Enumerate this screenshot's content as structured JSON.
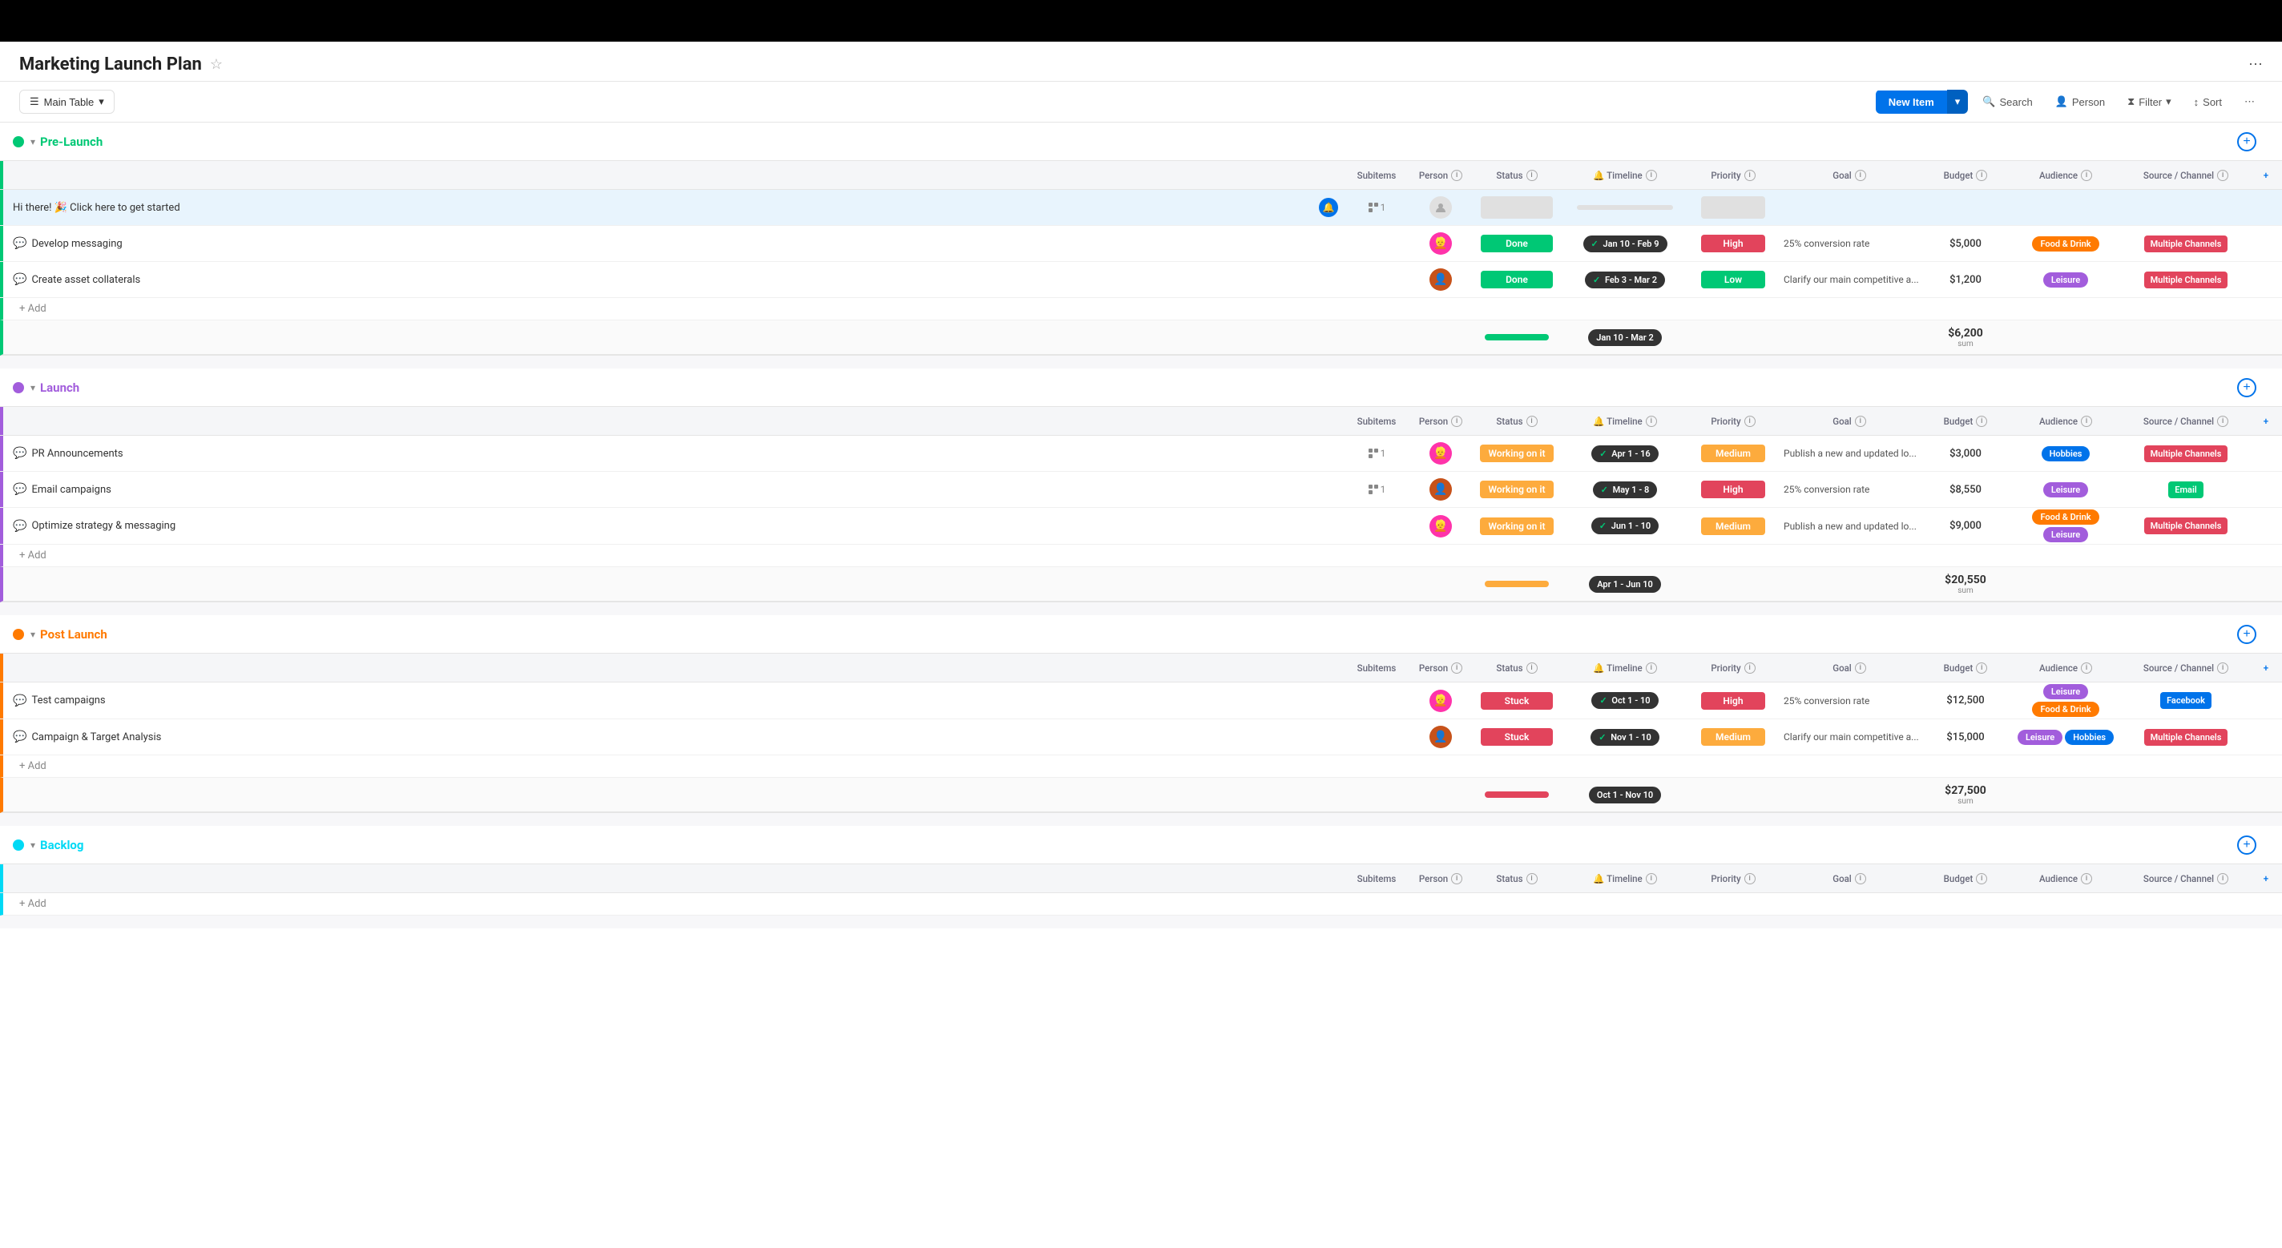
{
  "app": {
    "title": "Marketing Launch Plan",
    "more_icon": "⋯"
  },
  "toolbar": {
    "main_table_label": "Main Table",
    "new_item_label": "New Item",
    "search_label": "Search",
    "person_label": "Person",
    "filter_label": "Filter",
    "sort_label": "Sort",
    "more_label": "⋯"
  },
  "columns": {
    "name_label": "",
    "subitems_label": "Subitems",
    "person_label": "Person",
    "status_label": "Status",
    "timeline_label": "Timeline",
    "priority_label": "Priority",
    "goal_label": "Goal",
    "budget_label": "Budget",
    "audience_label": "Audience",
    "source_label": "Source / Channel"
  },
  "groups": [
    {
      "id": "pre-launch",
      "title": "Pre-Launch",
      "color": "green",
      "items": [
        {
          "name": "Hi there! 🎉 Click here to get started",
          "is_highlight": true,
          "subitems": "1",
          "person": "empty",
          "status": "",
          "status_class": "status-empty",
          "timeline": "",
          "priority": "",
          "priority_class": "priority-empty",
          "goal": "",
          "budget": "",
          "audience": [],
          "source": ""
        },
        {
          "name": "Develop messaging",
          "subitems": "",
          "person": "avatar1",
          "status": "Done",
          "status_class": "status-done",
          "timeline": "Jan 10 - Feb 9",
          "priority": "High",
          "priority_class": "priority-high",
          "goal": "25% conversion rate",
          "budget": "$5,000",
          "audience": [
            "Food & Drink"
          ],
          "audience_classes": [
            "aud-food"
          ],
          "source": "Multiple Channels",
          "source_class": "src-multi"
        },
        {
          "name": "Create asset collaterals",
          "subitems": "",
          "person": "avatar2",
          "status": "Done",
          "status_class": "status-done",
          "timeline": "Feb 3 - Mar 2",
          "priority": "Low",
          "priority_class": "priority-low",
          "goal": "Clarify our main competitive a...",
          "budget": "$1,200",
          "audience": [
            "Leisure"
          ],
          "audience_classes": [
            "aud-leisure"
          ],
          "source": "Multiple Channels",
          "source_class": "src-multi"
        }
      ],
      "summary_budget": "$6,200",
      "summary_timeline": "Jan 10 - Mar 2",
      "summary_status_pct": 100,
      "summary_status_color": "#00c875"
    },
    {
      "id": "launch",
      "title": "Launch",
      "color": "purple",
      "items": [
        {
          "name": "PR Announcements",
          "subitems": "1",
          "person": "avatar1",
          "status": "Working on it",
          "status_class": "status-working",
          "timeline": "Apr 1 - 16",
          "priority": "Medium",
          "priority_class": "priority-medium",
          "goal": "Publish a new and updated lo...",
          "budget": "$3,000",
          "audience": [
            "Hobbies"
          ],
          "audience_classes": [
            "aud-hobbies"
          ],
          "source": "Multiple Channels",
          "source_class": "src-multi"
        },
        {
          "name": "Email campaigns",
          "subitems": "1",
          "person": "avatar2",
          "status": "Working on it",
          "status_class": "status-working",
          "timeline": "May 1 - 8",
          "priority": "High",
          "priority_class": "priority-high",
          "goal": "25% conversion rate",
          "budget": "$8,550",
          "audience": [
            "Leisure"
          ],
          "audience_classes": [
            "aud-leisure"
          ],
          "source": "Email",
          "source_class": "src-email"
        },
        {
          "name": "Optimize strategy & messaging",
          "subitems": "",
          "person": "avatar1",
          "status": "Working on it",
          "status_class": "status-working",
          "timeline": "Jun 1 - 10",
          "priority": "Medium",
          "priority_class": "priority-medium",
          "goal": "Publish a new and updated lo...",
          "budget": "$9,000",
          "audience": [
            "Food & Drink",
            "Leisure"
          ],
          "audience_classes": [
            "aud-food",
            "aud-leisure"
          ],
          "source": "Multiple Channels",
          "source_class": "src-multi"
        }
      ],
      "summary_budget": "$20,550",
      "summary_timeline": "Apr 1 - Jun 10",
      "summary_status_pct": 100,
      "summary_status_color": "#fdab3d"
    },
    {
      "id": "post-launch",
      "title": "Post Launch",
      "color": "orange",
      "items": [
        {
          "name": "Test campaigns",
          "subitems": "",
          "person": "avatar1",
          "status": "Stuck",
          "status_class": "status-stuck",
          "timeline": "Oct 1 - 10",
          "priority": "High",
          "priority_class": "priority-high",
          "goal": "25% conversion rate",
          "budget": "$12,500",
          "audience": [
            "Leisure",
            "Food & Drink"
          ],
          "audience_classes": [
            "aud-leisure",
            "aud-food"
          ],
          "source": "Facebook",
          "source_class": "src-facebook"
        },
        {
          "name": "Campaign & Target Analysis",
          "subitems": "",
          "person": "avatar2",
          "status": "Stuck",
          "status_class": "status-stuck",
          "timeline": "Nov 1 - 10",
          "priority": "Medium",
          "priority_class": "priority-medium",
          "goal": "Clarify our main competitive a...",
          "budget": "$15,000",
          "audience": [
            "Leisure",
            "Hobbies"
          ],
          "audience_classes": [
            "aud-leisure",
            "aud-hobbies"
          ],
          "source": "Multiple Channels",
          "source_class": "src-multi"
        }
      ],
      "summary_budget": "$27,500",
      "summary_timeline": "Oct 1 - Nov 10",
      "summary_status_pct": 100,
      "summary_status_color": "#e2445c"
    },
    {
      "id": "backlog",
      "title": "Backlog",
      "color": "cyan",
      "items": []
    }
  ],
  "add_item_label": "+ Add",
  "sum_label": "sum"
}
